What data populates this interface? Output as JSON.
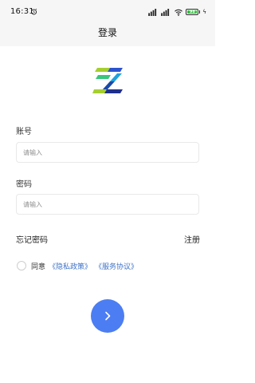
{
  "status_bar": {
    "time": "16:31",
    "battery_level": "98",
    "icons": [
      "alarm-icon",
      "signal-icon",
      "signal-icon",
      "wifi-icon",
      "battery-icon",
      "charge-icon"
    ]
  },
  "header": {
    "title": "登录"
  },
  "logo": {
    "name": "z-logo"
  },
  "form": {
    "account_label": "账号",
    "account_placeholder": "请输入",
    "password_label": "密码",
    "password_placeholder": "请输入",
    "forgot_password": "忘记密码",
    "register": "注册",
    "agree_prefix": "同意",
    "privacy_policy": "《隐私政策》",
    "service_agreement": "《服务协议》"
  },
  "colors": {
    "header_bg": "#f6f6f6",
    "accent": "#4c7df2",
    "link": "#3f73c8",
    "battery_green": "#2fbf3b"
  }
}
